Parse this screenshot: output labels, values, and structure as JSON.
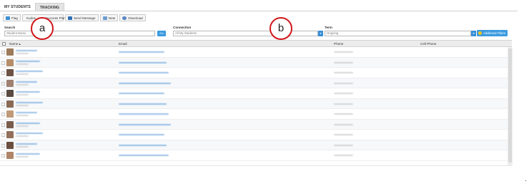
{
  "tabs": [
    {
      "label": "MY STUDENTS",
      "active": false
    },
    {
      "label": "TRACKING",
      "active": true
    }
  ],
  "toolbar": {
    "flag": "Flag",
    "kudos_plan": "Kudos",
    "success_plan": "Success Plan",
    "send_message": "Send Message",
    "note": "Note",
    "download": "Download"
  },
  "filters": {
    "search_label": "Search",
    "search_placeholder": "Student Name",
    "go_label": "Go",
    "connection_label": "Connection",
    "connection_value": "All My Students",
    "term_label": "Term",
    "term_value": "Ongoing",
    "additional_filters": "Additional Filters"
  },
  "callouts": {
    "a": "a",
    "b": "b"
  },
  "table": {
    "columns": {
      "name": "Name ▴",
      "email": "Email",
      "phone": "Phone",
      "cell": "Cell Phone"
    },
    "row_count": 11
  },
  "colors": {
    "accent": "#3c9be0",
    "callout_border": "#d0171b",
    "link": "#4a90d6"
  }
}
